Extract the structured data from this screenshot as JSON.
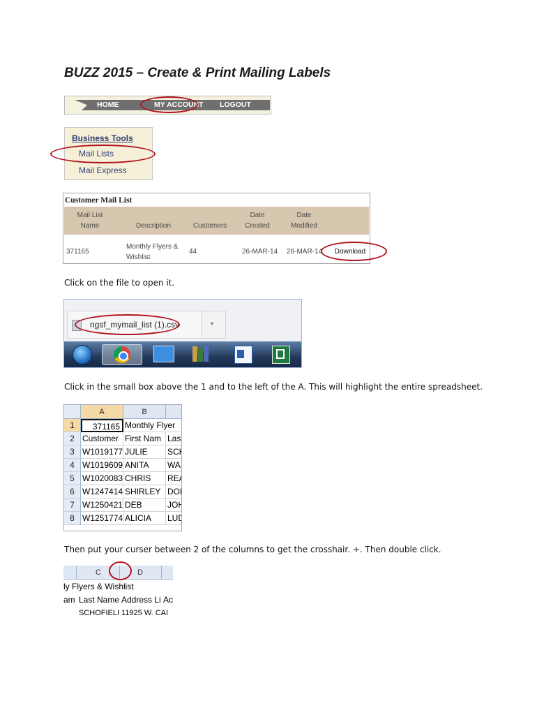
{
  "title": "BUZZ 2015 – Create & Print Mailing Labels",
  "nav": {
    "home": "HOME",
    "my_account": "MY ACCOUNT",
    "logout": "LOGOUT"
  },
  "business_tools": {
    "header": "Business Tools",
    "mail_lists": "Mail Lists",
    "mail_express": "Mail Express"
  },
  "customer_mail_list": {
    "title": "Customer Mail List",
    "headers": {
      "name_1": "Mail List",
      "name_2": "Name",
      "description": "Description",
      "customers": "Customers",
      "created_1": "Date",
      "created_2": "Created",
      "modified_1": "Date",
      "modified_2": "Modified"
    },
    "row": {
      "name": "371165",
      "desc_1": "Monthly Flyers &",
      "desc_2": "Wishlist",
      "customers": "44",
      "created": "26-MAR-14",
      "modified": "26-MAR-14",
      "action": "Download"
    }
  },
  "instructions": {
    "open_file": "Click on the file to open it.",
    "highlight": "Click in the small box above the 1 and to the left of the A. This will highlight the entire spreadsheet.",
    "crosshair": "Then put your curser between 2 of the columns to get the crosshair. +.  Then double click."
  },
  "download_bar": {
    "filename": "ngsf_mymail_list (1).csv",
    "dropdown_glyph": "▾"
  },
  "spreadsheet1": {
    "col_a": "A",
    "col_b": "B",
    "rows": [
      {
        "num": "1",
        "a": "371165",
        "b": "Monthly Flyer",
        "c": ""
      },
      {
        "num": "2",
        "a": "Customer",
        "b": "First Nam",
        "c": "Last"
      },
      {
        "num": "3",
        "a": "W1019177",
        "b": "JULIE",
        "c": "SCH"
      },
      {
        "num": "4",
        "a": "W1019609",
        "b": "ANITA",
        "c": "WA"
      },
      {
        "num": "5",
        "a": "W1020083",
        "b": "CHRIS",
        "c": "REA"
      },
      {
        "num": "6",
        "a": "W1247414",
        "b": "SHIRLEY",
        "c": "DOE"
      },
      {
        "num": "7",
        "a": "W1250421",
        "b": "DEB",
        "c": "JOH"
      },
      {
        "num": "8",
        "a": "W1251774",
        "b": "ALICIA",
        "c": "LUD"
      }
    ]
  },
  "spreadsheet2": {
    "col_c": "C",
    "col_d": "D",
    "line1": "ly Flyers & Wishlist",
    "line2_a": "am",
    "line2_b": "Last Name",
    "line2_c": "Address Li",
    "line2_d": "Ac",
    "line3_a": "SCHOFIELI",
    "line3_b": "11925 W. CAI"
  },
  "colors": {
    "annotation_red": "#b3121d",
    "nav_gray": "#6f6f6f",
    "table_header": "#d7c7ae"
  }
}
